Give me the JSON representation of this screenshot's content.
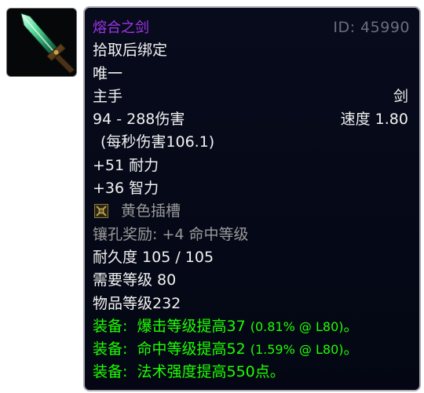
{
  "item": {
    "icon": "emerald-sword-icon",
    "name": "熔合之剑",
    "id_text": "ID: 45990",
    "binding": "拾取后绑定",
    "uniqueness": "唯一",
    "slot": "主手",
    "weapon_type": "剑",
    "damage": "94 - 288伤害",
    "speed": "速度 1.80",
    "dps": "(每秒伤害106.1)",
    "stat_stamina": "+51 耐力",
    "stat_intellect": "+36 智力",
    "socket_icon": "yellow-socket-icon",
    "socket": "黄色插槽",
    "socket_bonus": "镶孔奖励: +4 命中等级",
    "durability": "耐久度 105 / 105",
    "required_level": "需要等级 80",
    "item_level": "物品等级232",
    "equip_effects": [
      {
        "prefix": "装备:",
        "text": "爆击等级提高37",
        "detail": "(0.81% @ L80)",
        "suffix": "。"
      },
      {
        "prefix": "装备:",
        "text": "命中等级提高52",
        "detail": "(1.59% @ L80)",
        "suffix": "。"
      },
      {
        "prefix": "装备:",
        "text": "法术强度提高550点",
        "detail": "",
        "suffix": "。"
      }
    ]
  },
  "colors": {
    "epic_name": "#a335ee",
    "equip_green": "#1eff00",
    "muted_gray": "#9a9a9a",
    "id_gray": "#6b6e7a",
    "tooltip_bg": "#070b1c",
    "tooltip_border": "#a9aab3"
  }
}
